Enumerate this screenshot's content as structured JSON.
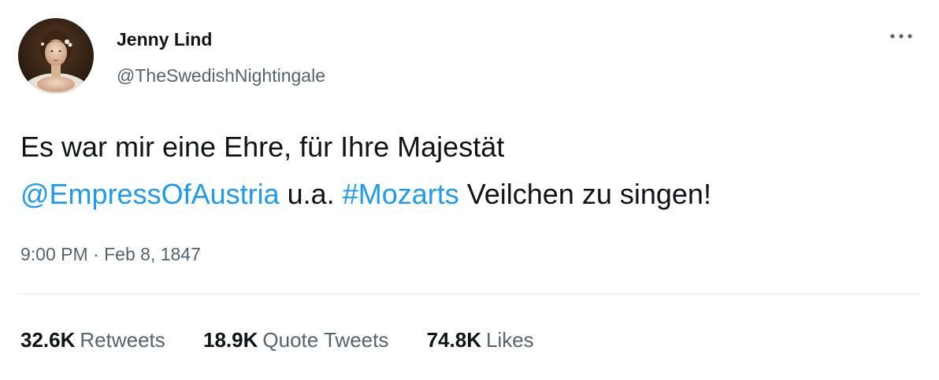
{
  "author": {
    "display_name": "Jenny Lind",
    "handle": "@TheSwedishNightingale",
    "avatar_icon": "portrait-avatar"
  },
  "menu": {
    "icon": "more-horizontal-icon"
  },
  "tweet": {
    "line1": "Es war mir eine Ehre, für Ihre Majestät",
    "mention": "@EmpressOfAustria",
    "mid_text": " u.a. ",
    "hashtag": "#Mozarts",
    "end_text": " Veilchen zu singen!",
    "time": "9:00 PM",
    "separator": " · ",
    "date": "Feb 8, 1847"
  },
  "stats": {
    "retweets_count": "32.6K",
    "retweets_label": "Retweets",
    "quotes_count": "18.9K",
    "quotes_label": "Quote Tweets",
    "likes_count": "74.8K",
    "likes_label": "Likes"
  },
  "colors": {
    "text": "#0f1419",
    "secondary": "#536471",
    "link": "#1d9bf0",
    "divider": "#eff3f4"
  }
}
